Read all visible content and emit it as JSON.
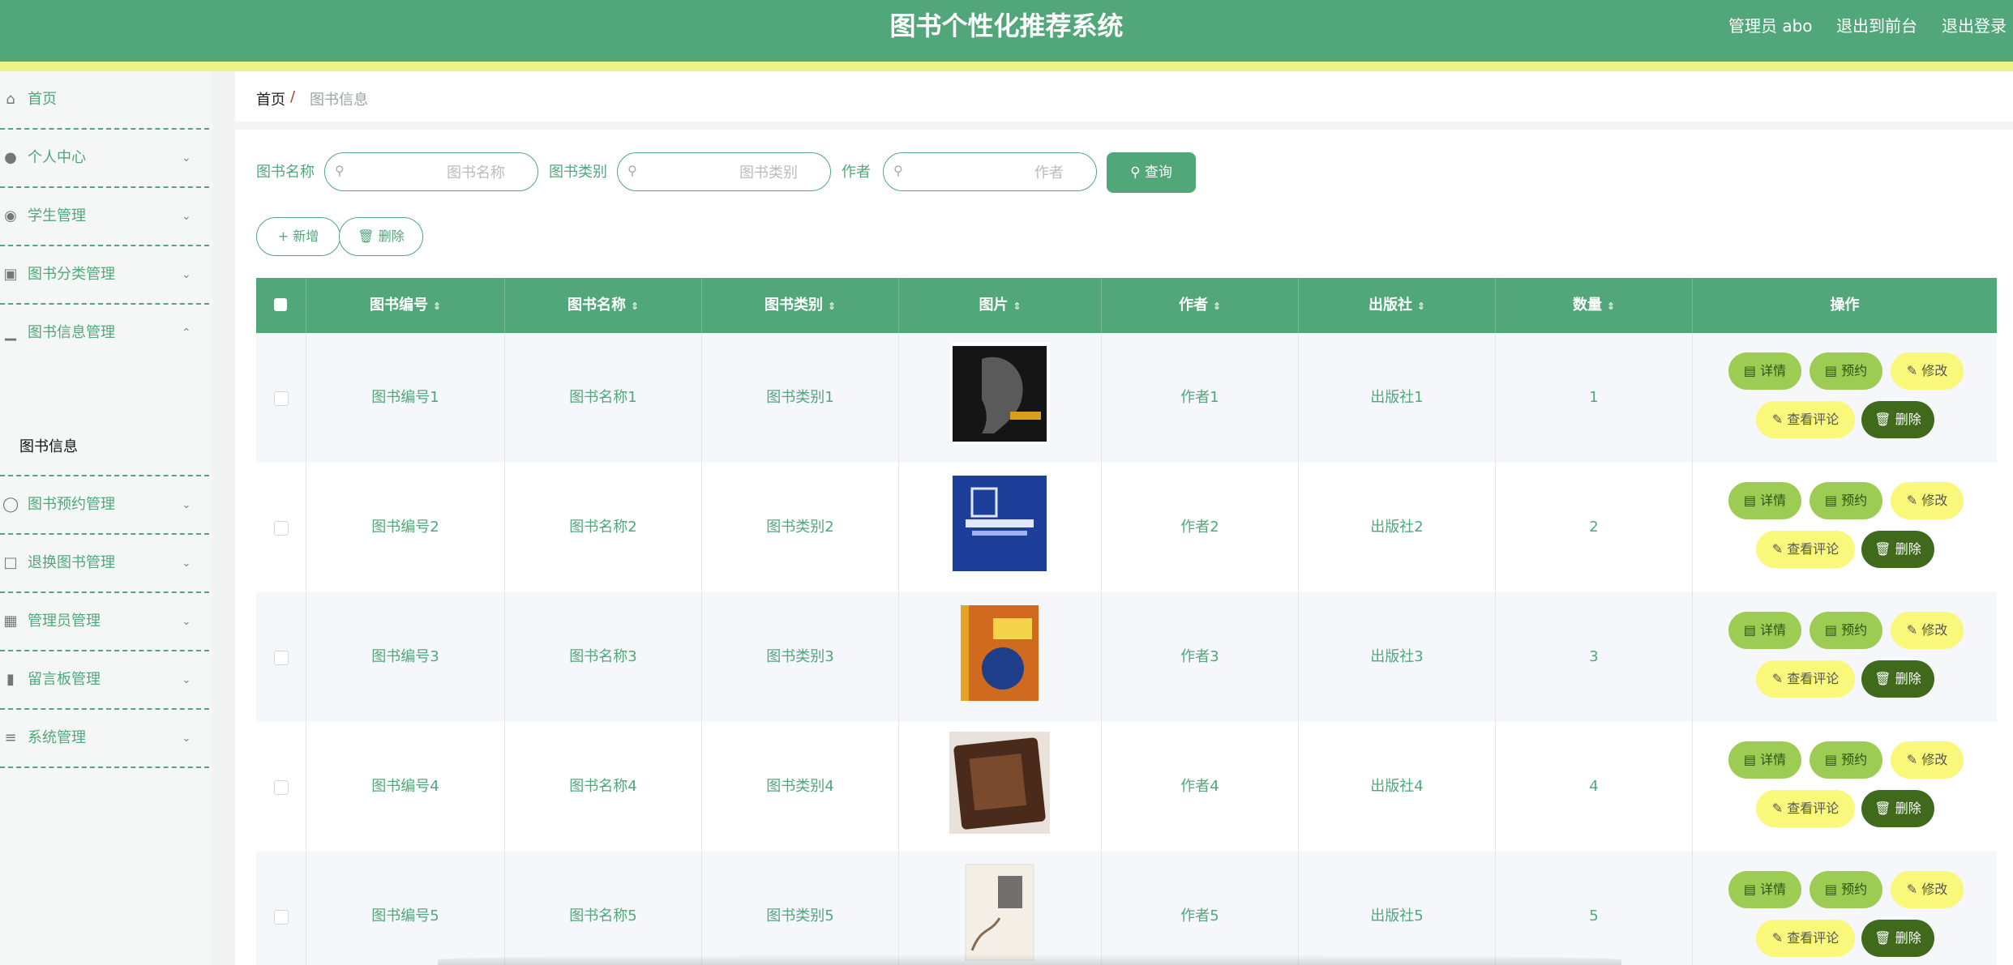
{
  "header": {
    "title": "图书个性化推荐系统",
    "admin_label": "管理员 abo",
    "back_frontend": "退出到前台",
    "logout": "退出登录"
  },
  "colors": {
    "primary": "#52a77a",
    "accent_line": "#e9f58c",
    "detail_btn": "#9ccc54",
    "edit_btn": "#f9f87a",
    "delete_btn": "#3f6a1c"
  },
  "sidebar": {
    "items": [
      {
        "label": "首页",
        "icon": "home-icon"
      },
      {
        "label": "个人中心",
        "icon": "user-icon"
      },
      {
        "label": "学生管理",
        "icon": "palette-icon"
      },
      {
        "label": "图书分类管理",
        "icon": "briefcase-icon"
      },
      {
        "label": "图书信息管理",
        "icon": "bar-chart-icon"
      },
      {
        "label": "图书预约管理",
        "icon": "microphone-icon"
      },
      {
        "label": "退换图书管理",
        "icon": "fullscreen-icon"
      },
      {
        "label": "管理员管理",
        "icon": "ticket-icon"
      },
      {
        "label": "留言板管理",
        "icon": "books-icon"
      },
      {
        "label": "系统管理",
        "icon": "list-icon"
      }
    ],
    "sub_item": "图书信息"
  },
  "breadcrumb": {
    "home": "首页",
    "separator": "/",
    "current": "图书信息"
  },
  "filters": {
    "name_label": "图书名称",
    "name_placeholder": "图书名称",
    "category_label": "图书类别",
    "category_placeholder": "图书类别",
    "author_label": "作者",
    "author_placeholder": "作者",
    "query_button": "查询"
  },
  "actions": {
    "add": "新增",
    "delete": "删除"
  },
  "table": {
    "columns": [
      "图书编号",
      "图书名称",
      "图书类别",
      "图片",
      "作者",
      "出版社",
      "数量",
      "操作"
    ],
    "row_buttons": {
      "detail": "详情",
      "reserve": "预约",
      "edit": "修改",
      "review": "查看评论",
      "delete": "删除"
    },
    "rows": [
      {
        "id": "图书编号1",
        "name": "图书名称1",
        "category": "图书类别1",
        "author": "作者1",
        "publisher": "出版社1",
        "qty": "1"
      },
      {
        "id": "图书编号2",
        "name": "图书名称2",
        "category": "图书类别2",
        "author": "作者2",
        "publisher": "出版社2",
        "qty": "2"
      },
      {
        "id": "图书编号3",
        "name": "图书名称3",
        "category": "图书类别3",
        "author": "作者3",
        "publisher": "出版社3",
        "qty": "3"
      },
      {
        "id": "图书编号4",
        "name": "图书名称4",
        "category": "图书类别4",
        "author": "作者4",
        "publisher": "出版社4",
        "qty": "4"
      },
      {
        "id": "图书编号5",
        "name": "图书名称5",
        "category": "图书类别5",
        "author": "作者5",
        "publisher": "出版社5",
        "qty": "5"
      }
    ]
  }
}
